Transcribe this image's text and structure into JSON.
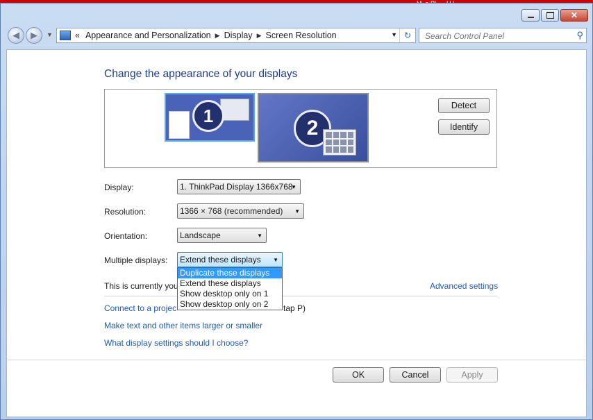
{
  "window": {
    "minimize_icon": "minimize-icon",
    "maximize_icon": "maximize-icon",
    "close_icon": "close-icon",
    "top_strip_text": "M..a Pl..... H.l."
  },
  "nav": {
    "breadcrumb_prefix": "«",
    "breadcrumbs": [
      "Appearance and Personalization",
      "Display",
      "Screen Resolution"
    ],
    "search_placeholder": "Search Control Panel"
  },
  "main": {
    "title": "Change the appearance of your displays",
    "monitor1_number": "1",
    "monitor2_number": "2",
    "detect_label": "Detect",
    "identify_label": "Identify",
    "display_label": "Display:",
    "display_value": "1. ThinkPad Display 1366x768",
    "resolution_label": "Resolution:",
    "resolution_value": "1366 × 768 (recommended)",
    "orientation_label": "Orientation:",
    "orientation_value": "Landscape",
    "multiple_label": "Multiple displays:",
    "multiple_value": "Extend these displays",
    "multiple_options": [
      "Duplicate these displays",
      "Extend these displays",
      "Show desktop only on 1",
      "Show desktop only on 2"
    ],
    "current_text": "This is currently you",
    "advanced_link": "Advanced settings",
    "projector_link_start": "Connect to a projec",
    "projector_link_end": "tap P)",
    "text_size_link": "Make text and other items larger or smaller",
    "help_link": "What display settings should I choose?",
    "ok_label": "OK",
    "cancel_label": "Cancel",
    "apply_label": "Apply"
  }
}
